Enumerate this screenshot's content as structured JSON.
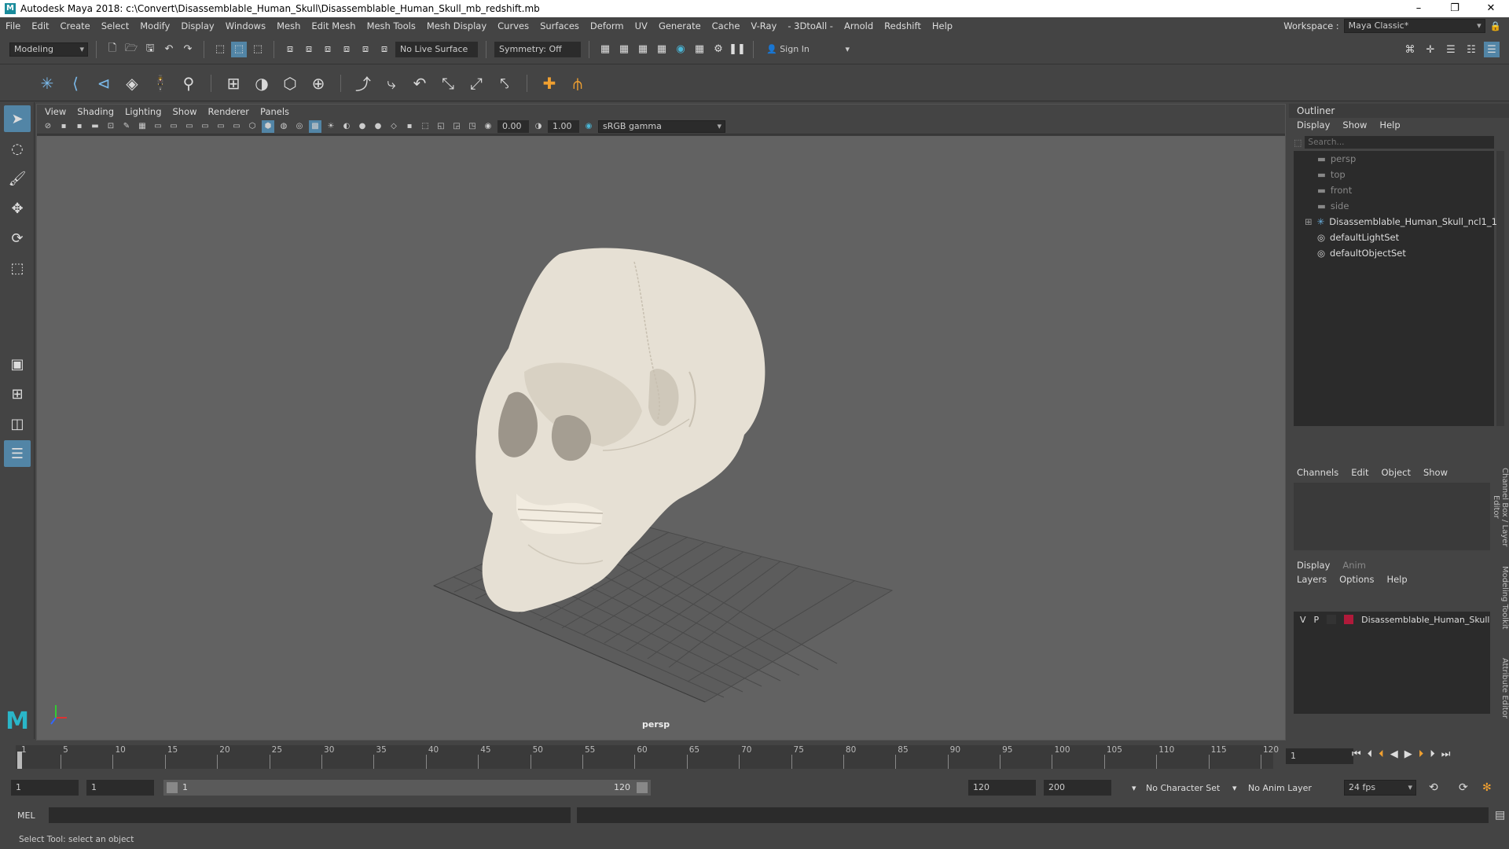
{
  "window": {
    "title": "Autodesk Maya 2018: c:\\Convert\\Disassemblable_Human_Skull\\Disassemblable_Human_Skull_mb_redshift.mb",
    "logo": "M",
    "minimize": "–",
    "maximize": "❐",
    "close": "✕"
  },
  "menubar": {
    "items": [
      "File",
      "Edit",
      "Create",
      "Select",
      "Modify",
      "Display",
      "Windows",
      "Mesh",
      "Edit Mesh",
      "Mesh Tools",
      "Mesh Display",
      "Curves",
      "Surfaces",
      "Deform",
      "UV",
      "Generate",
      "Cache",
      "V-Ray",
      "- 3DtoAll -",
      "Arnold",
      "Redshift",
      "Help"
    ],
    "workspace_label": "Workspace :",
    "workspace_value": "Maya Classic*"
  },
  "statusline": {
    "mode": "Modeling",
    "live_surface": "No Live Surface",
    "symmetry": "Symmetry: Off",
    "sign_in": "Sign In"
  },
  "viewport": {
    "menu": [
      "View",
      "Shading",
      "Lighting",
      "Show",
      "Renderer",
      "Panels"
    ],
    "exposure": "0.00",
    "gamma": "1.00",
    "color_space": "sRGB gamma",
    "camera_label": "persp"
  },
  "outliner": {
    "title": "Outliner",
    "menu": [
      "Display",
      "Show",
      "Help"
    ],
    "search_placeholder": "Search...",
    "items": [
      {
        "label": "persp",
        "icon": "camera-icon",
        "dim": true
      },
      {
        "label": "top",
        "icon": "camera-icon",
        "dim": true
      },
      {
        "label": "front",
        "icon": "camera-icon",
        "dim": true
      },
      {
        "label": "side",
        "icon": "camera-icon",
        "dim": true
      },
      {
        "label": "Disassemblable_Human_Skull_ncl1_1",
        "icon": "transform-icon",
        "dim": false
      },
      {
        "label": "defaultLightSet",
        "icon": "set-icon",
        "dim": false
      },
      {
        "label": "defaultObjectSet",
        "icon": "set-icon",
        "dim": false
      }
    ]
  },
  "channelbox": {
    "menu": [
      "Channels",
      "Edit",
      "Object",
      "Show"
    ],
    "side_tab": "Channel Box / Layer Editor"
  },
  "layereditor": {
    "tabs": [
      "Display",
      "Anim"
    ],
    "menu": [
      "Layers",
      "Options",
      "Help"
    ],
    "layer": {
      "v": "V",
      "p": "P",
      "name": "Disassemblable_Human_Skull",
      "color": "#b01a3a"
    },
    "side_tab_1": "Modeling Toolkit",
    "side_tab_2": "Attribute Editor"
  },
  "timeslider": {
    "ticks": [
      "1",
      "5",
      "10",
      "15",
      "20",
      "25",
      "30",
      "35",
      "40",
      "45",
      "50",
      "55",
      "60",
      "65",
      "70",
      "75",
      "80",
      "85",
      "90",
      "95",
      "100",
      "105",
      "110",
      "115",
      "120"
    ],
    "current_frame": "1"
  },
  "rangeslider": {
    "start_time": "1",
    "playback_start": "1",
    "range_start_label": "1",
    "range_end_label": "120",
    "playback_end": "120",
    "end_time": "200",
    "character_set": "No Character Set",
    "anim_layer": "No Anim Layer",
    "fps": "24 fps"
  },
  "cmdline": {
    "mode": "MEL"
  },
  "helpline": {
    "text": "Select Tool: select an object"
  },
  "colors": {
    "accent": "#5285a6",
    "skull": "#e8e2d6",
    "viewport_bg": "#626262"
  }
}
